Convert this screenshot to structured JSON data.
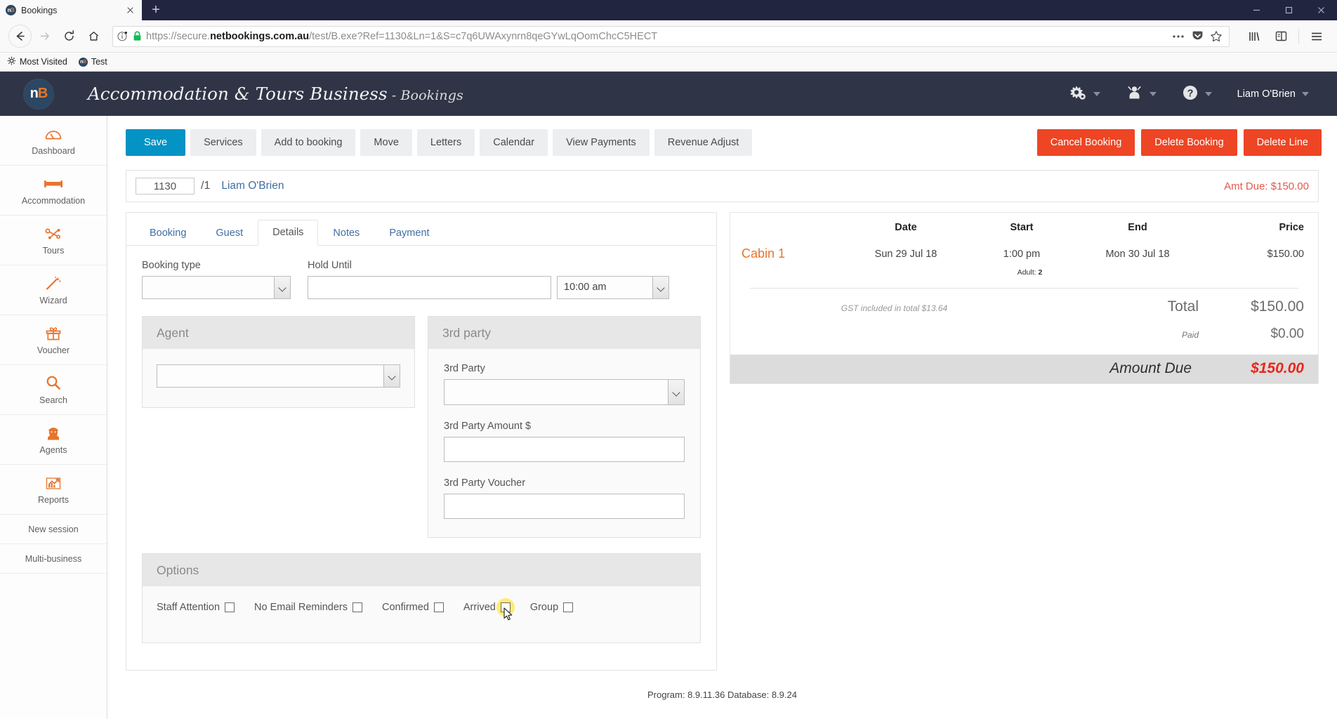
{
  "browser": {
    "tab": {
      "title": "Bookings",
      "favicon": "nb-logo-icon",
      "close": "close-icon"
    },
    "newtab_label": "+",
    "window_controls": {
      "minimize": "minimize-icon",
      "maximize": "maximize-icon",
      "close": "close-icon"
    },
    "nav": {
      "back": "back-arrow-icon",
      "forward": "forward-arrow-icon",
      "reload": "reload-icon",
      "home": "home-icon"
    },
    "url": {
      "scheme": "https://secure.",
      "domain": "netbookings.com.au",
      "path": "/test/B.exe?Ref=1130&Ln=1&S=c7q6UWAxynrn8qeGYwLqOomChcC5HECT",
      "full": "https://secure.netbookings.com.au/test/B.exe?Ref=1130&Ln=1&S=c7q6UWAxynrn8qeGYwLqOomChcC5HECT",
      "security": "lock-icon",
      "info": "page-info-icon"
    },
    "url_actions": [
      "more-icon",
      "pocket-icon",
      "bookmark-star-icon"
    ],
    "nav_tools": [
      "library-icon",
      "sidebar-icon",
      "hamburger-menu-icon"
    ],
    "bookmarks": [
      {
        "label": "Most Visited",
        "icon": "star-gear-icon"
      },
      {
        "label": "Test",
        "icon": "nb-logo-icon"
      }
    ]
  },
  "app": {
    "logo": {
      "text_n": "n",
      "text_b": "B"
    },
    "title_main": "Accommodation & Tours Business",
    "title_sep": " - ",
    "title_sub": "Bookings",
    "header_actions": [
      {
        "name": "settings",
        "icon": "gear-icon"
      },
      {
        "name": "user-admin",
        "icon": "person-icon"
      },
      {
        "name": "help",
        "icon": "question-mark-icon"
      }
    ],
    "username": "Liam O'Brien"
  },
  "sidebar": {
    "items": [
      {
        "label": "Dashboard",
        "icon": "gauge-icon"
      },
      {
        "label": "Accommodation",
        "icon": "bed-icon"
      },
      {
        "label": "Tours",
        "icon": "route-icon"
      },
      {
        "label": "Wizard",
        "icon": "magic-wand-icon"
      },
      {
        "label": "Voucher",
        "icon": "gift-icon"
      },
      {
        "label": "Search",
        "icon": "magnifier-icon"
      },
      {
        "label": "Agents",
        "icon": "agent-person-icon"
      },
      {
        "label": "Reports",
        "icon": "chart-growth-icon"
      }
    ],
    "plain_items": [
      {
        "label": "New session"
      },
      {
        "label": "Multi-business"
      }
    ]
  },
  "toolbar": {
    "left": [
      {
        "label": "Save",
        "style": "primary"
      },
      {
        "label": "Services",
        "style": "default"
      },
      {
        "label": "Add to booking",
        "style": "default"
      },
      {
        "label": "Move",
        "style": "default"
      },
      {
        "label": "Letters",
        "style": "default"
      },
      {
        "label": "Calendar",
        "style": "default"
      },
      {
        "label": "View Payments",
        "style": "default"
      },
      {
        "label": "Revenue Adjust",
        "style": "default"
      }
    ],
    "right": [
      {
        "label": "Cancel Booking"
      },
      {
        "label": "Delete Booking"
      },
      {
        "label": "Delete Line"
      }
    ]
  },
  "booking_bar": {
    "ref_value": "1130",
    "line": "/1",
    "guest_name": "Liam O'Brien",
    "amount_due_label": "Amt Due: $150.00"
  },
  "tabs": [
    {
      "label": "Booking",
      "active": false
    },
    {
      "label": "Guest",
      "active": false
    },
    {
      "label": "Details",
      "active": true
    },
    {
      "label": "Notes",
      "active": false
    },
    {
      "label": "Payment",
      "active": false
    }
  ],
  "details": {
    "booking_type": {
      "label": "Booking type",
      "value": ""
    },
    "hold_until": {
      "label": "Hold Until",
      "value": ""
    },
    "hold_time": {
      "value": "10:00 am"
    },
    "agent_panel": {
      "title": "Agent",
      "agent_select_value": ""
    },
    "third_party_panel": {
      "title": "3rd party",
      "fields": [
        {
          "label": "3rd Party",
          "value": "",
          "type": "select"
        },
        {
          "label": "3rd Party Amount $",
          "value": "",
          "type": "text"
        },
        {
          "label": "3rd Party Voucher",
          "value": "",
          "type": "text"
        }
      ]
    },
    "options_panel": {
      "title": "Options",
      "checkboxes": [
        {
          "label": "Staff Attention",
          "checked": false,
          "highlighted": false
        },
        {
          "label": "No Email Reminders",
          "checked": false,
          "highlighted": false
        },
        {
          "label": "Confirmed",
          "checked": false,
          "highlighted": false
        },
        {
          "label": "Arrived",
          "checked": false,
          "highlighted": true
        },
        {
          "label": "Group",
          "checked": false,
          "highlighted": false
        }
      ]
    }
  },
  "summary": {
    "headers": {
      "item": "",
      "date": "Date",
      "start": "Start",
      "end": "End",
      "price": "Price"
    },
    "rows": [
      {
        "item": "Cabin 1",
        "date": "Sun 29 Jul 18",
        "start": "1:00 pm",
        "end": "Mon 30 Jul 18",
        "price": "$150.00",
        "pax_label": "Adult:",
        "pax_value": "2"
      }
    ],
    "gst_note": "GST included in total $13.64",
    "total_label": "Total",
    "total_value": "$150.00",
    "paid_label": "Paid",
    "paid_value": "$0.00",
    "due_label": "Amount Due",
    "due_value": "$150.00"
  },
  "footer": {
    "text": "Program: 8.9.11.36 Database: 8.9.24"
  },
  "colors": {
    "accent_orange": "#e8742c",
    "header_dark": "#2f3546",
    "primary_blue": "#0393c4",
    "danger_red": "#ee4524",
    "due_red": "#e8271c",
    "link_blue": "#3f6fa5",
    "highlight_yellow": "#ffe94d"
  }
}
